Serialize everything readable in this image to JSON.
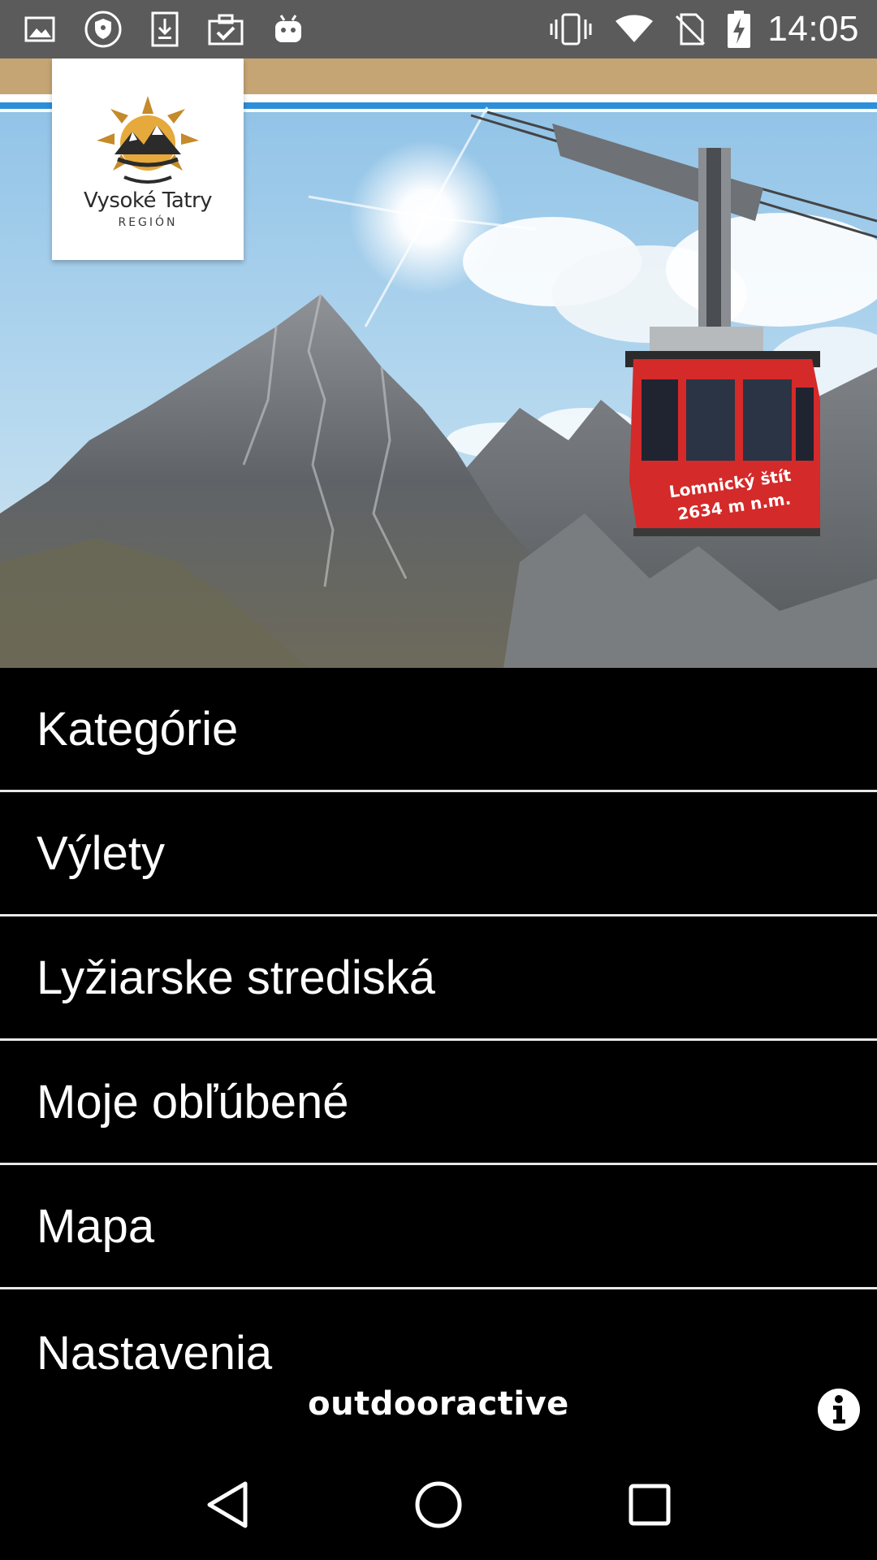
{
  "status_bar": {
    "time": "14:05",
    "left_icons": [
      "image-icon",
      "shield-icon",
      "download-icon",
      "clipboard-check-icon",
      "android-icon"
    ],
    "right_icons": [
      "vibrate-icon",
      "wifi-icon",
      "no-sim-icon",
      "battery-charging-icon"
    ]
  },
  "header": {
    "logo_title": "Vysoké Tatry",
    "logo_subtitle": "REGIÓN",
    "gondola_name": "Lomnický štít",
    "gondola_altitude": "2634 m n.m."
  },
  "menu": {
    "items": [
      {
        "label": "Kategórie"
      },
      {
        "label": "Výlety"
      },
      {
        "label": "Lyžiarske strediská"
      },
      {
        "label": "Moje obľúbené"
      },
      {
        "label": "Mapa"
      },
      {
        "label": "Nastavenia"
      }
    ]
  },
  "footer": {
    "brand": "outdooractive",
    "info_icon": "info-icon"
  },
  "nav_bar": {
    "icons": [
      "back-icon",
      "home-icon",
      "recents-icon"
    ]
  },
  "colors": {
    "status_bar": "#5b5b5b",
    "background": "#000000",
    "menu_text": "#ffffff",
    "divider": "#e8e8e8",
    "banner_stripe": "#c6a574",
    "gondola": "#d42a2a"
  }
}
